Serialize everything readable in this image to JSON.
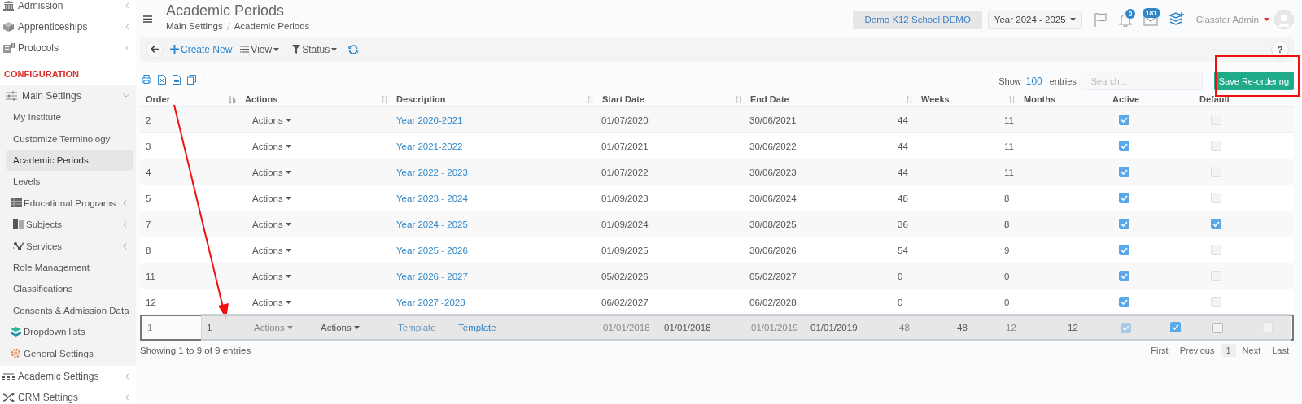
{
  "sidebar": {
    "items": [
      {
        "kind": "menu",
        "label": "Admission",
        "expanded": false,
        "selected": false
      },
      {
        "kind": "menu",
        "label": "Apprenticeships",
        "expanded": false,
        "selected": false
      },
      {
        "kind": "menu",
        "label": "Protocols",
        "expanded": false,
        "selected": false
      },
      {
        "kind": "section",
        "label": "CONFIGURATION"
      },
      {
        "kind": "menu",
        "label": "Main Settings",
        "expanded": true,
        "selected": false,
        "children": [
          {
            "label": "My Institute",
            "selected": false
          },
          {
            "label": "Customize Terminology",
            "selected": false
          },
          {
            "label": "Academic Periods",
            "selected": true
          },
          {
            "label": "Levels",
            "selected": false
          },
          {
            "label": "Educational Programs",
            "selected": false,
            "expanded": false
          },
          {
            "label": "Subjects",
            "selected": false,
            "expanded": false
          },
          {
            "label": "Services",
            "selected": false,
            "expanded": false
          },
          {
            "label": "Role Management",
            "selected": false
          },
          {
            "label": "Classifications",
            "selected": false
          },
          {
            "label": "Consents & Admission Data",
            "selected": false
          },
          {
            "label": "Dropdown lists",
            "selected": false
          },
          {
            "label": "General Settings",
            "selected": false
          }
        ]
      },
      {
        "kind": "menu",
        "label": "Academic Settings",
        "expanded": false,
        "selected": false
      },
      {
        "kind": "menu",
        "label": "CRM Settings",
        "expanded": false,
        "selected": false
      }
    ]
  },
  "header": {
    "title": "Academic Periods",
    "breadcrumb": [
      "Main Settings",
      "Academic Periods"
    ],
    "school": "Demo K12 School DEMO",
    "year": "Year 2024 - 2025",
    "notifications": "0",
    "messages": "181",
    "user": "Classter Admin"
  },
  "toolbar": {
    "buttons": [
      {
        "kind": "back"
      },
      {
        "kind": "create",
        "label": "Create New"
      },
      {
        "kind": "view",
        "label": "View"
      },
      {
        "kind": "status",
        "label": "Status"
      },
      {
        "kind": "refresh"
      }
    ],
    "help": "?"
  },
  "table": {
    "show_label": "Show",
    "page_length": "100",
    "entries_label": "entries",
    "search": {
      "placeholder": "Search..."
    },
    "save_button": "Save Re-ordering",
    "columns": [
      {
        "label": "Order",
        "sorted": true
      },
      {
        "label": "Actions",
        "sorted": false
      },
      {
        "label": "Description",
        "sorted": false
      },
      {
        "label": "Start Date",
        "sorted": false
      },
      {
        "label": "End Date",
        "sorted": false
      },
      {
        "label": "Weeks",
        "sorted": false
      },
      {
        "label": "Months"
      },
      {
        "label": "Active"
      },
      {
        "label": "Default"
      }
    ],
    "rows": [
      {
        "order": "2",
        "actions": "Actions",
        "description": "Year 2020-2021",
        "start_date": "01/07/2020",
        "end_date": "30/06/2021",
        "weeks": "44",
        "months": "11",
        "active": true,
        "default": false,
        "dragging": false
      },
      {
        "order": "3",
        "actions": "Actions",
        "description": "Year 2021-2022",
        "start_date": "01/07/2021",
        "end_date": "30/06/2022",
        "weeks": "44",
        "months": "11",
        "active": true,
        "default": false,
        "dragging": false
      },
      {
        "order": "4",
        "actions": "Actions",
        "description": "Year 2022 - 2023",
        "start_date": "01/07/2022",
        "end_date": "30/06/2023",
        "weeks": "44",
        "months": "11",
        "active": true,
        "default": false,
        "dragging": false
      },
      {
        "order": "5",
        "actions": "Actions",
        "description": "Year 2023 - 2024",
        "start_date": "01/09/2023",
        "end_date": "30/06/2024",
        "weeks": "48",
        "months": "8",
        "active": true,
        "default": false,
        "dragging": false
      },
      {
        "order": "7",
        "actions": "Actions",
        "description": "Year 2024 - 2025",
        "start_date": "01/09/2024",
        "end_date": "30/08/2025",
        "weeks": "36",
        "months": "8",
        "active": true,
        "default": true,
        "dragging": false
      },
      {
        "order": "8",
        "actions": "Actions",
        "description": "Year 2025 - 2026",
        "start_date": "01/09/2025",
        "end_date": "30/06/2026",
        "weeks": "54",
        "months": "9",
        "active": true,
        "default": false,
        "dragging": false
      },
      {
        "order": "11",
        "actions": "Actions",
        "description": "Year 2026 - 2027",
        "start_date": "05/02/2026",
        "end_date": "05/02/2027",
        "weeks": "0",
        "months": "0",
        "active": true,
        "default": false,
        "dragging": false
      },
      {
        "order": "12",
        "actions": "Actions",
        "description": "Year 2027 -2028",
        "start_date": "06/02/2027",
        "end_date": "06/02/2028",
        "weeks": "0",
        "months": "0",
        "active": true,
        "default": false,
        "dragging": false
      },
      {
        "order": "1",
        "actions": "Actions",
        "description": "Template",
        "start_date": "01/01/2018",
        "end_date": "01/01/2019",
        "weeks": "48",
        "months": "12",
        "active": true,
        "default": false,
        "dragging": true
      }
    ],
    "drag_preview": {
      "order": "1",
      "actions": "Actions",
      "description": "Template",
      "start_date": "01/01/2018",
      "end_date": "01/01/2019",
      "weeks": "48",
      "months": "12",
      "active": true,
      "default": false
    },
    "info": "Showing 1 to 9 of 9 entries",
    "pagination": [
      {
        "label": "First",
        "selected": false
      },
      {
        "label": "Previous",
        "selected": false
      },
      {
        "label": "1",
        "selected": true
      },
      {
        "label": "Next",
        "selected": false
      },
      {
        "label": "Last",
        "selected": false
      }
    ]
  }
}
